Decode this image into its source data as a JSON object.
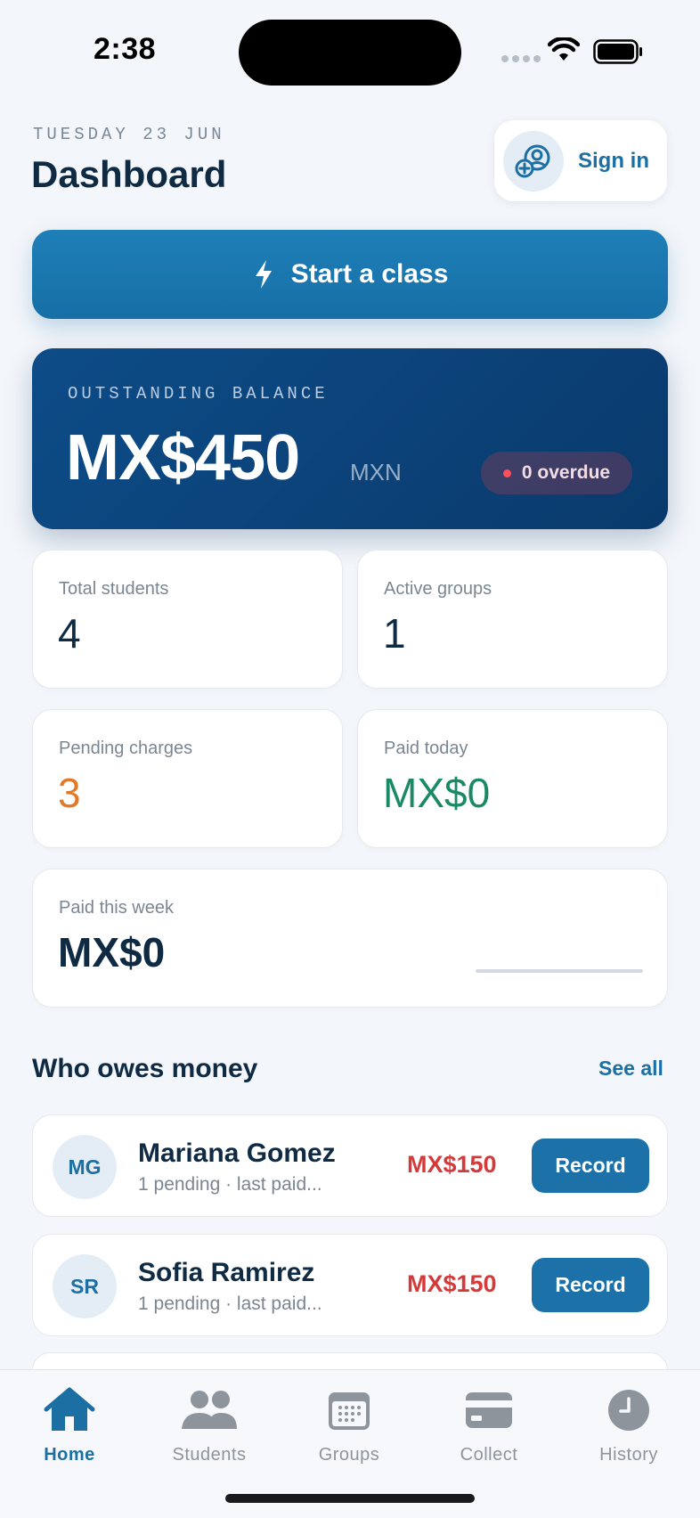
{
  "status_bar": {
    "time": "2:38"
  },
  "header": {
    "date": "TUESDAY 23 JUN",
    "title": "Dashboard",
    "sign_in_label": "Sign in"
  },
  "start_class": {
    "label": "Start a class"
  },
  "balance": {
    "label": "OUTSTANDING BALANCE",
    "amount": "MX$450",
    "currency": "MXN",
    "overdue": "0 overdue"
  },
  "stats": {
    "total_students": {
      "label": "Total students",
      "value": "4"
    },
    "active_groups": {
      "label": "Active groups",
      "value": "1"
    },
    "pending_charges": {
      "label": "Pending charges",
      "value": "3"
    },
    "paid_today": {
      "label": "Paid today",
      "value": "MX$0"
    },
    "paid_week": {
      "label": "Paid this week",
      "value": "MX$0"
    }
  },
  "owes": {
    "title": "Who owes money",
    "see_all": "See all",
    "items": [
      {
        "initials": "MG",
        "name": "Mariana Gomez",
        "sub": "1 pending · last paid...",
        "amount": "MX$150",
        "action": "Record"
      },
      {
        "initials": "SR",
        "name": "Sofia Ramirez",
        "sub": "1 pending · last paid...",
        "amount": "MX$150",
        "action": "Record"
      }
    ]
  },
  "tabs": [
    {
      "label": "Home",
      "icon": "home-icon",
      "active": true
    },
    {
      "label": "Students",
      "icon": "students-icon",
      "active": false
    },
    {
      "label": "Groups",
      "icon": "groups-icon",
      "active": false
    },
    {
      "label": "Collect",
      "icon": "card-icon",
      "active": false
    },
    {
      "label": "History",
      "icon": "clock-icon",
      "active": false
    }
  ],
  "colors": {
    "accent": "#1c6fa3",
    "balance_card": "#0a3a6c",
    "pending": "#e07a2a",
    "paid": "#1a8a66",
    "debt": "#d43a3a"
  }
}
